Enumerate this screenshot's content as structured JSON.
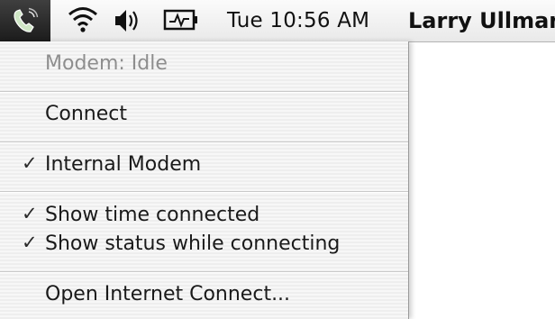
{
  "menubar": {
    "modem_icon": "modem-phone-icon",
    "wifi_icon": "wifi-icon",
    "volume_icon": "volume-icon",
    "battery_icon": "battery-charging-icon",
    "clock": "Tue 10:56 AM",
    "user": "Larry Ullman"
  },
  "menu": {
    "status": "Modem: Idle",
    "connect": "Connect",
    "internal_modem": "Internal Modem",
    "show_time_connected": "Show time connected",
    "show_status_while_connecting": "Show status while connecting",
    "open_internet_connect": "Open Internet Connect...",
    "check_glyph": "✓"
  },
  "colors": {
    "menubar_bg": "#eeeeee",
    "active_extra_bg": "#2a2a2a",
    "disabled_text": "#8e8e8e"
  }
}
